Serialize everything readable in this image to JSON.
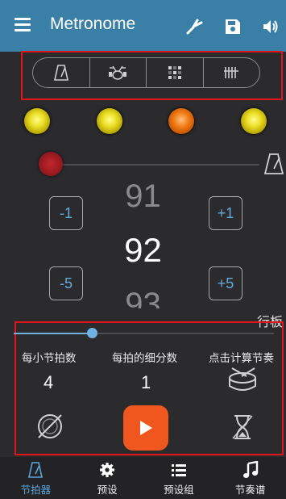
{
  "appbar": {
    "title": "Metronome",
    "menu_icon": "menu-icon",
    "actions": [
      "tuning-fork-icon",
      "save-icon",
      "volume-icon"
    ]
  },
  "mode_tabs": [
    "metronome-icon",
    "drum-kit-icon",
    "grid-pattern-icon",
    "bars-icon"
  ],
  "beat_lights": [
    "#e6dc24",
    "#e6dc24",
    "#ef7418",
    "#e6dc24"
  ],
  "tempo": {
    "previous": "91",
    "current": "92",
    "next": "93",
    "minus1": "-1",
    "plus1": "+1",
    "minus5": "-5",
    "plus5": "+5",
    "marking": "行板"
  },
  "tempo_slider": {
    "fraction": 0.3
  },
  "settings": {
    "beats_label": "每小节拍数",
    "beats_value": "4",
    "subdivision_label": "每拍的细分数",
    "subdivision_value": "1",
    "tap_label": "点击计算节奏"
  },
  "bottom_nav": [
    {
      "label": "节拍器",
      "icon": "metronome-icon",
      "active": true
    },
    {
      "label": "预设",
      "icon": "gear-icon",
      "active": false
    },
    {
      "label": "预设组",
      "icon": "list-icon",
      "active": false
    },
    {
      "label": "节奏谱",
      "icon": "music-note-icon",
      "active": false
    }
  ],
  "colors": {
    "appbar": "#3a7fa6",
    "background": "#2b2b2d",
    "accent": "#5aa6dc",
    "play": "#f0571e",
    "highlight_box": "#e1161a"
  }
}
